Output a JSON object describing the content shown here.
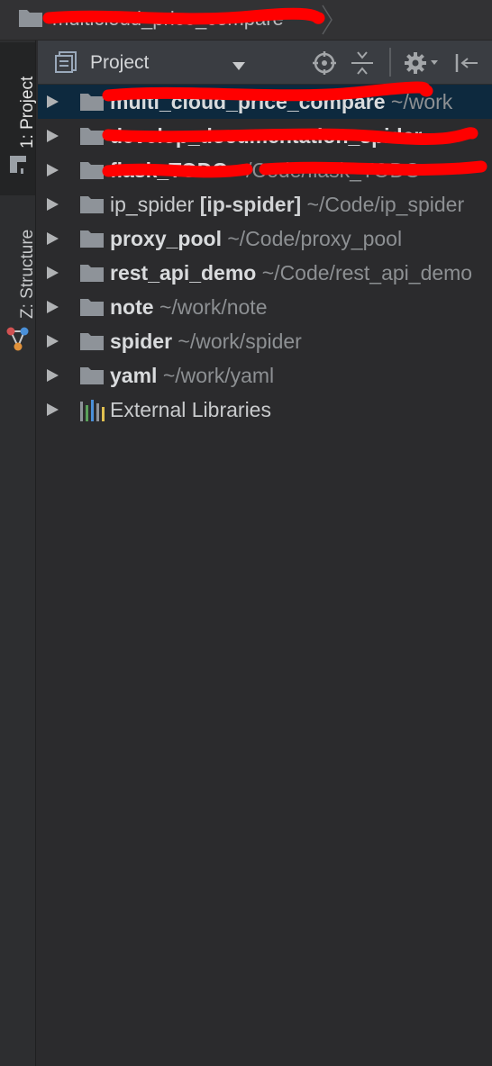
{
  "breadcrumb": {
    "project_name": "multicloud_price_compare"
  },
  "sidebar": {
    "tabs": [
      {
        "label": "1: Project",
        "selected": true
      },
      {
        "label": "Z: Structure",
        "selected": false
      }
    ]
  },
  "toolbar": {
    "title": "Project"
  },
  "tree": {
    "items": [
      {
        "name": "multi_cloud_price_compare",
        "module": "",
        "path": "~/work",
        "redacted": true,
        "selected": true,
        "icon": "folder-icon"
      },
      {
        "name": "develop_documentation_spider",
        "module": "",
        "path": "~",
        "redacted": true,
        "selected": false,
        "icon": "folder-icon"
      },
      {
        "name": "flask_TODO",
        "module": "",
        "path": "~/Code/flask_TODO",
        "redacted": true,
        "selected": false,
        "icon": "folder-icon"
      },
      {
        "name": "ip_spider",
        "module": "[ip-spider]",
        "path": "~/Code/ip_spider",
        "redacted": false,
        "selected": false,
        "icon": "folder-icon"
      },
      {
        "name": "proxy_pool",
        "module": "",
        "path": "~/Code/proxy_pool",
        "redacted": false,
        "selected": false,
        "icon": "folder-icon"
      },
      {
        "name": "rest_api_demo",
        "module": "",
        "path": "~/Code/rest_api_demo",
        "redacted": false,
        "selected": false,
        "icon": "folder-icon"
      },
      {
        "name": "note",
        "module": "",
        "path": "~/work/note",
        "redacted": false,
        "selected": false,
        "icon": "folder-icon"
      },
      {
        "name": "spider",
        "module": "",
        "path": "~/work/spider",
        "redacted": false,
        "selected": false,
        "icon": "folder-icon"
      },
      {
        "name": "yaml",
        "module": "",
        "path": "~/work/yaml",
        "redacted": false,
        "selected": false,
        "icon": "folder-icon"
      },
      {
        "name": "External Libraries",
        "module": "",
        "path": "",
        "redacted": false,
        "selected": false,
        "icon": "libraries-icon"
      }
    ]
  },
  "colors": {
    "background": "#2b2b2d",
    "selection": "#0d293e",
    "redaction": "#ff0000"
  }
}
